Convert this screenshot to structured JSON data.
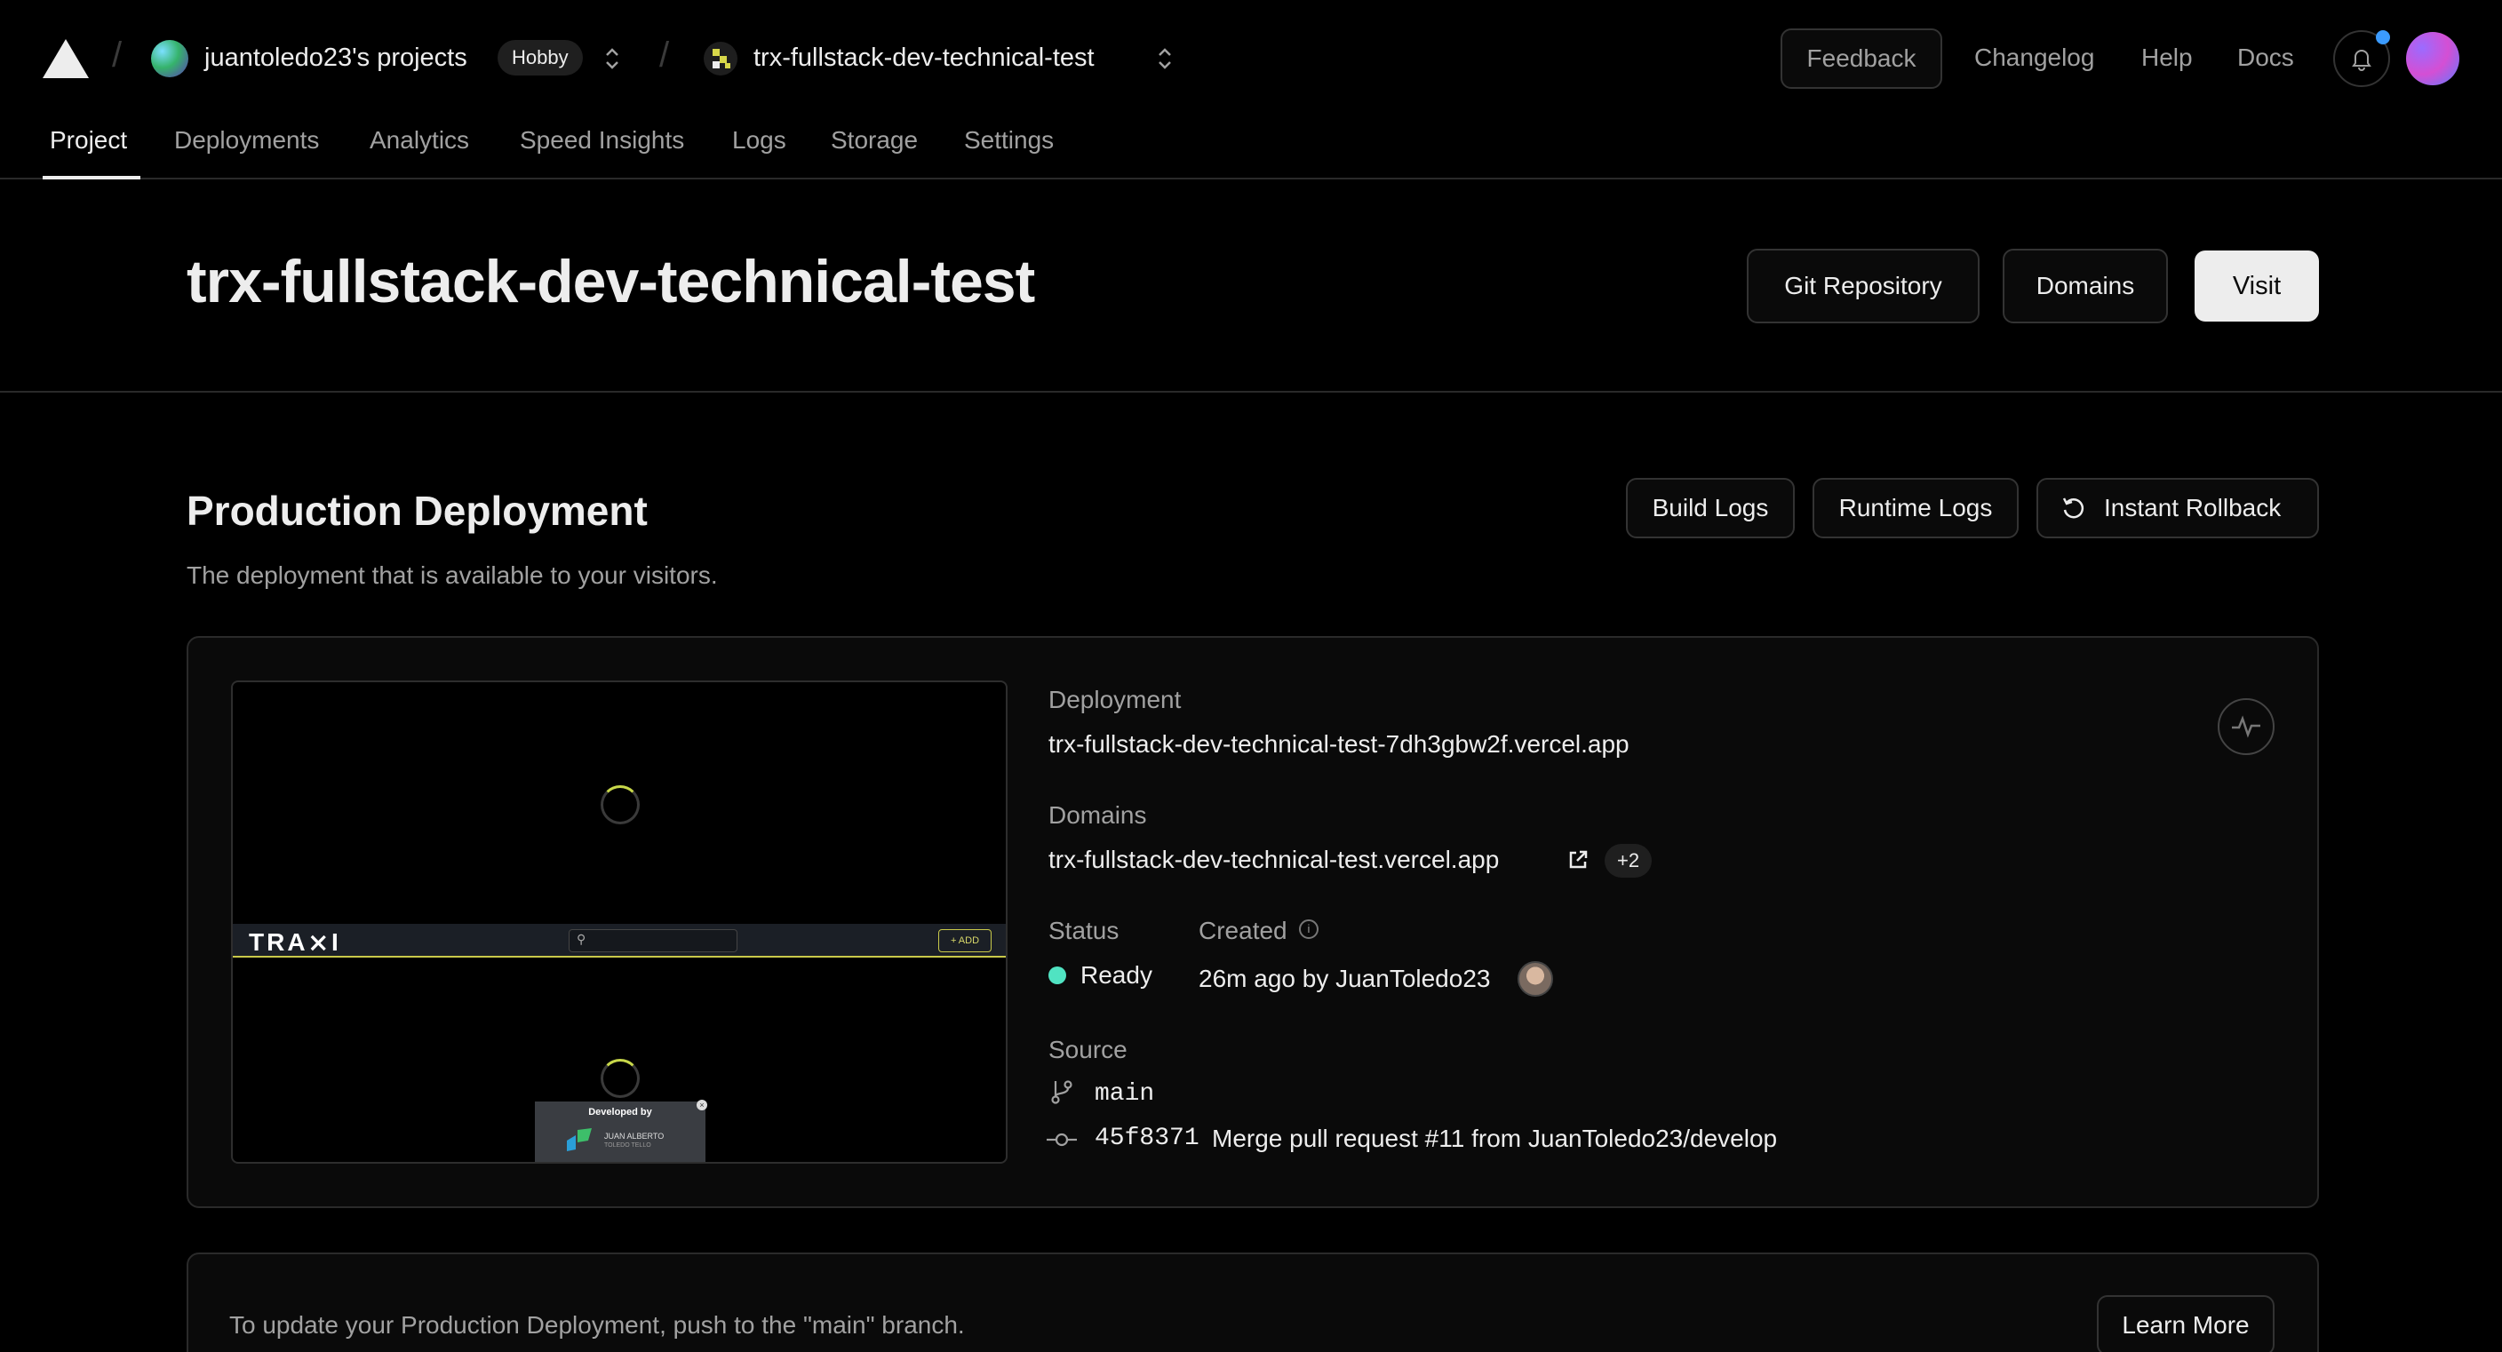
{
  "header": {
    "team_name": "juantoledo23's projects",
    "plan_badge": "Hobby",
    "project_name": "trx-fullstack-dev-technical-test",
    "feedback_label": "Feedback",
    "nav_links": [
      "Changelog",
      "Help",
      "Docs"
    ]
  },
  "tabs": [
    "Project",
    "Deployments",
    "Analytics",
    "Speed Insights",
    "Logs",
    "Storage",
    "Settings"
  ],
  "active_tab": "Project",
  "project": {
    "title": "trx-fullstack-dev-technical-test",
    "git_button": "Git Repository",
    "domains_button": "Domains",
    "visit_button": "Visit"
  },
  "production": {
    "title": "Production Deployment",
    "subtitle": "The deployment that is available to your visitors.",
    "build_logs": "Build Logs",
    "runtime_logs": "Runtime Logs",
    "rollback": "Instant Rollback"
  },
  "deployment": {
    "deployment_label": "Deployment",
    "deployment_url": "trx-fullstack-dev-technical-test-7dh3gbw2f.vercel.app",
    "domains_label": "Domains",
    "domain": "trx-fullstack-dev-technical-test.vercel.app",
    "extra_domains": "+2",
    "status_label": "Status",
    "status": "Ready",
    "created_label": "Created",
    "created": "26m ago by JuanToledo23",
    "source_label": "Source",
    "branch": "main",
    "commit_hash": "45f8371",
    "commit_message": "Merge pull request #11 from JuanToledo23/develop"
  },
  "preview": {
    "app_logo": "TRA⨯I",
    "add_label": "+ ADD",
    "developed_by": "Developed by",
    "dev_name": "JUAN ALBERTO",
    "dev_surname": "TOLEDO TELLO"
  },
  "footer_card": {
    "text": "To update your Production Deployment, push to the \"main\" branch.",
    "learn_more": "Learn More"
  },
  "colors": {
    "background": "#000000",
    "status_ready": "#50e3c2",
    "notification_dot": "#3b9bff",
    "visit_button_bg": "#ededed"
  },
  "icons": [
    "vercel-logo-icon",
    "chevron-updown-icon",
    "bell-icon",
    "rollback-icon",
    "external-link-icon",
    "info-icon",
    "branch-icon",
    "commit-icon",
    "activity-icon"
  ]
}
